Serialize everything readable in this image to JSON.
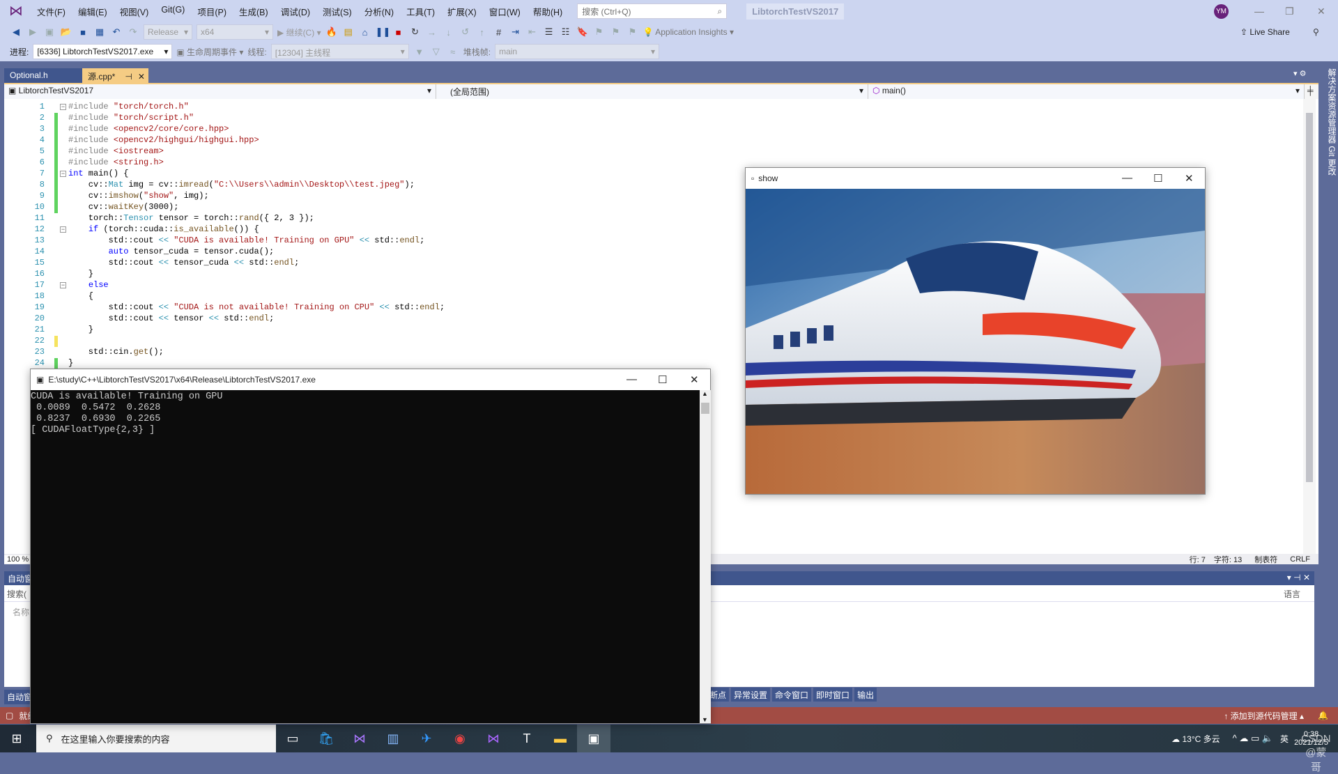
{
  "app": {
    "solution_title": "LibtorchTestVS2017",
    "avatar": "YM",
    "logo_icon": "visual-studio-logo"
  },
  "menu": [
    "文件(F)",
    "编辑(E)",
    "视图(V)",
    "Git(G)",
    "项目(P)",
    "生成(B)",
    "调试(D)",
    "测试(S)",
    "分析(N)",
    "工具(T)",
    "扩展(X)",
    "窗口(W)",
    "帮助(H)"
  ],
  "search": {
    "placeholder": "搜索 (Ctrl+Q)"
  },
  "toolbar": {
    "config": "Release",
    "platform": "x64",
    "continue": "继续(C)",
    "app_insights": "Application Insights",
    "live_share": "Live Share"
  },
  "debugbar": {
    "process_label": "进程:",
    "process": "[6336] LibtorchTestVS2017.exe",
    "lifecycle": "生命周期事件",
    "thread_label": "线程:",
    "thread": "[12304] 主线程",
    "stack_label": "堆栈帧:",
    "stack": "main"
  },
  "tabs": [
    {
      "label": "Optional.h"
    },
    {
      "label": "源.cpp*"
    }
  ],
  "navbar": {
    "project": "LibtorchTestVS2017",
    "scope": "(全局范围)",
    "member": "main()"
  },
  "editor": {
    "zoom": "100 %",
    "line": "行: 7",
    "char": "字符: 13",
    "tabs": "制表符",
    "eol": "CRLF"
  },
  "code_lines": [
    "#include \"torch/torch.h\"",
    "#include \"torch/script.h\"",
    "#include <opencv2/core/core.hpp>",
    "#include <opencv2/highgui/highgui.hpp>",
    "#include <iostream>",
    "#include <string.h>",
    "int main() {",
    "    cv::Mat img = cv::imread(\"C:\\\\Users\\\\admin\\\\Desktop\\\\test.jpeg\");",
    "    cv::imshow(\"show\", img);",
    "    cv::waitKey(3000);",
    "    torch::Tensor tensor = torch::rand({ 2, 3 });",
    "    if (torch::cuda::is_available()) {",
    "        std::cout << \"CUDA is available! Training on GPU\" << std::endl;",
    "        auto tensor_cuda = tensor.cuda();",
    "        std::cout << tensor_cuda << std::endl;",
    "    }",
    "    else",
    "    {",
    "        std::cout << \"CUDA is not available! Training on CPU\" << std::endl;",
    "        std::cout << tensor << std::endl;",
    "    }",
    "",
    "    std::cin.get();",
    "}"
  ],
  "panel": {
    "title": "自动窗口",
    "search": "搜索(",
    "col_name": "名称",
    "col_lang": "语言",
    "footer_tab": "自动窗口"
  },
  "bottom_tabs": [
    "断点",
    "异常设置",
    "命令窗口",
    "即时窗口",
    "输出"
  ],
  "statusbar": {
    "ready": "就绪",
    "source_control": "添加到源代码管理"
  },
  "right_strip": "解决方案资源管理器  Git 更改",
  "console": {
    "title": "E:\\study\\C++\\LibtorchTestVS2017\\x64\\Release\\LibtorchTestVS2017.exe",
    "output": "CUDA is available! Training on GPU\n 0.0089  0.5472  0.2628\n 0.8237  0.6930  0.2265\n[ CUDAFloatType{2,3} ]"
  },
  "show_window": {
    "title": "show"
  },
  "taskbar": {
    "search": "在这里输入你要搜索的内容",
    "weather": "13°C 多云",
    "ime": "英",
    "time": "0:38",
    "date": "2021/12/5",
    "watermark": "CSDN @蒙哥"
  },
  "colors": {
    "accent": "#5d6b99",
    "tab_active": "#f5cc84",
    "status": "#a24c44"
  }
}
